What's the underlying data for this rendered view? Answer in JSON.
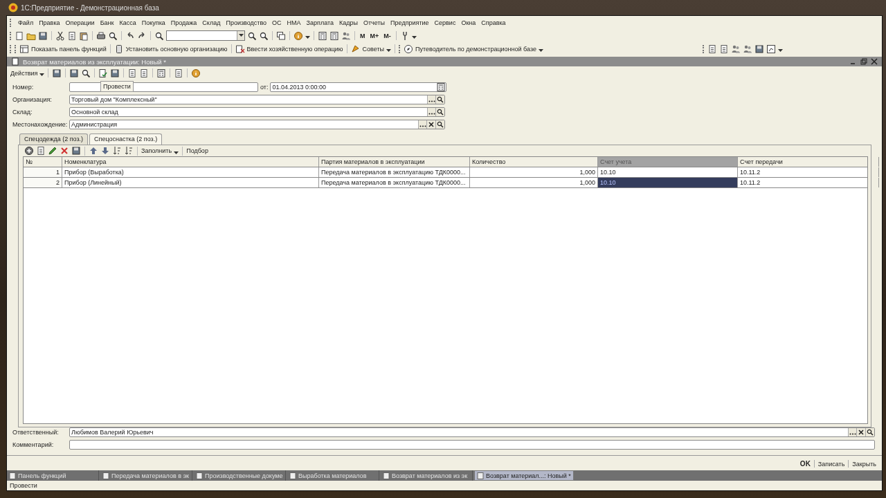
{
  "window": {
    "title": "1С:Предприятие - Демонстрационная база"
  },
  "menu": [
    "Файл",
    "Правка",
    "Операции",
    "Банк",
    "Касса",
    "Покупка",
    "Продажа",
    "Склад",
    "Производство",
    "ОС",
    "НМА",
    "Зарплата",
    "Кадры",
    "Отчеты",
    "Предприятие",
    "Сервис",
    "Окна",
    "Справка"
  ],
  "toolbar": {
    "memory_buttons": [
      "M",
      "M+",
      "M-"
    ]
  },
  "panel_toolbar": [
    "Показать панель функций",
    "Установить основную организацию",
    "Ввести хозяйственную операцию",
    "Советы",
    "Путеводитель по демонстрационной базе"
  ],
  "document": {
    "title": "Возврат материалов из эксплуатации: Новый *",
    "actions_menu": "Действия",
    "tooltip": "Провести",
    "number": {
      "label": "Номер:"
    },
    "date": {
      "label": "от:",
      "value": "01.04.2013  0:00:00"
    },
    "fields": [
      {
        "label": "Организация:",
        "value": "Торговый дом \"Комплексный\"",
        "clearable": false
      },
      {
        "label": "Склад:",
        "value": "Основной склад",
        "clearable": false
      },
      {
        "label": "Местонахождение:",
        "value": "Администрация",
        "clearable": true
      }
    ],
    "tabs": [
      {
        "label": "Спецодежда (2 поз.)",
        "selected": false
      },
      {
        "label": "Спецоснастка (2 поз.)",
        "selected": true
      }
    ],
    "table_toolbar": [
      "Заполнить",
      "Подбор"
    ],
    "table": {
      "columns": [
        {
          "label": "№",
          "selected": false
        },
        {
          "label": "Номенклатура",
          "selected": false
        },
        {
          "label": "Партия материалов в эксплуатации",
          "selected": false
        },
        {
          "label": "Количество",
          "selected": false
        },
        {
          "label": "Счет учета",
          "selected": true
        },
        {
          "label": "Счет передачи",
          "selected": false
        }
      ],
      "rows": [
        {
          "cells": [
            "1",
            "Прибор (Выработка)",
            "Передача материалов в эксплуатацию ТДК0000...",
            "1,000",
            "10.10",
            "10.11.2"
          ],
          "selected": false
        },
        {
          "cells": [
            "2",
            "Прибор (Линейный)",
            "Передача материалов в эксплуатацию ТДК0000...",
            "1,000",
            "10.10",
            "10.11.2"
          ],
          "selected": true
        }
      ]
    },
    "responsible": {
      "label": "Ответственный:",
      "value": "Любимов Валерий Юрьевич"
    },
    "comment": {
      "label": "Комментарий:"
    },
    "buttons": [
      {
        "label": "OK",
        "default": true
      },
      {
        "label": "Записать",
        "default": false
      },
      {
        "label": "Закрыть",
        "default": false
      }
    ]
  },
  "taskbar": [
    {
      "label": "Панель функций",
      "selected": false
    },
    {
      "label": "Передача материалов в эк",
      "selected": false
    },
    {
      "label": "Производственные докуме",
      "selected": false
    },
    {
      "label": "Выработка материалов",
      "selected": false
    },
    {
      "label": "Возврат материалов из эк",
      "selected": false
    },
    {
      "label": "Возврат материал...: Новый *",
      "selected": true
    }
  ],
  "status_bar": "Провести"
}
